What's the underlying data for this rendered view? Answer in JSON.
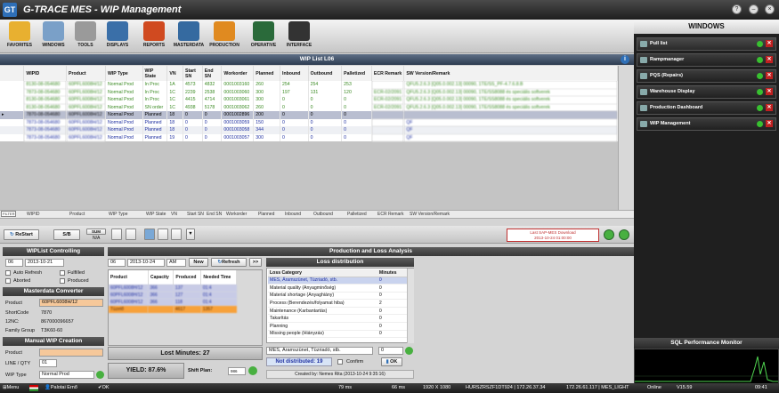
{
  "app": {
    "title": "G-TRACE MES  -  WIP Management",
    "logo": "GT"
  },
  "toolbar": [
    {
      "label": "FAVORITES",
      "icon": "star-folder-icon",
      "color": "#e8b030"
    },
    {
      "label": "WINDOWS",
      "icon": "windows-icon",
      "color": "#7aa0c8"
    },
    {
      "label": "TOOLS",
      "icon": "tools-icon",
      "color": "#9a9a9a"
    },
    {
      "label": "DISPLAYS",
      "icon": "display-icon",
      "color": "#3a6fa8"
    },
    {
      "label": "REPORTS",
      "icon": "bar-chart-icon",
      "color": "#d04a20"
    },
    {
      "label": "MASTERDATA",
      "icon": "database-icon",
      "color": "#356aa0"
    },
    {
      "label": "PRODUCTION",
      "icon": "factory-icon",
      "color": "#e08a20"
    },
    {
      "label": "OPERATIVE",
      "icon": "monitor-chart-icon",
      "color": "#2a6a3a"
    },
    {
      "label": "INTERFACE",
      "icon": "interface-icon",
      "color": "#333333"
    }
  ],
  "windows": {
    "header": "WINDOWS",
    "items": [
      "Pull list",
      "Rampmanager",
      "PQS (Repairs)",
      "Warehouse Display",
      "Production Dashboard",
      "WIP Management"
    ],
    "sql_title": "SQL Performance Monitor"
  },
  "wip": {
    "title": "WIP List L06",
    "columns": [
      "WIPID",
      "Product",
      "WIP Type",
      "WIP State",
      "VN",
      "Start SN",
      "End SN",
      "Workorder",
      "Planned",
      "Inbound",
      "Outbound",
      "Palletized",
      "ECR Remark",
      "SW Version/Remark"
    ],
    "rows": [
      {
        "cls": "g",
        "cells": [
          "8130-08-054680",
          "60PFL6008H/12",
          "Normal Prod",
          "In Proc",
          "1A",
          "4573",
          "4832",
          "0001003160",
          "260",
          "254",
          "254",
          "253",
          "",
          "QFU5.2.6.3 [Q05.0.002.13] 00090, 1TE/SS_PF-4.7.6.8.B"
        ]
      },
      {
        "cls": "g",
        "cells": [
          "7873-08-054680",
          "60PFL6008H/12",
          "Normal Prod",
          "In Proc",
          "1C",
          "2239",
          "2538",
          "0001003060",
          "300",
          "197",
          "131",
          "120",
          "ECR-02/2091",
          "QFU5.2.6.3 [Q05.0.002.13] 00090, 1TE/SS8088 és speciális softverek"
        ]
      },
      {
        "cls": "g",
        "cells": [
          "8130-08-054680",
          "60PFL6008H/12",
          "Normal Prod",
          "In Proc",
          "1C",
          "4415",
          "4714",
          "0001003061",
          "300",
          "0",
          "0",
          "0",
          "ECR-02/2091",
          "QFU5.2.6.3 [Q05.0.002.13] 00090, 1TE/SS8088 és speciális softverek"
        ]
      },
      {
        "cls": "g",
        "cells": [
          "8130-08-054680",
          "60PFL6008H/12",
          "Normal Prod",
          "SN order",
          "1C",
          "4938",
          "5178",
          "0001003062",
          "260",
          "0",
          "0",
          "0",
          "ECR-02/2091",
          "QFU5.2.6.3 [Q05.0.002.13] 00090, 1TE/SS8088 és speciális softverek"
        ]
      },
      {
        "cls": "b sel",
        "cells": [
          "7870-08-054680",
          "60PFL6008H/12",
          "Normal Prod",
          "Planned",
          "18",
          "0",
          "0",
          "0001002896",
          "200",
          "0",
          "0",
          "0",
          "",
          ""
        ]
      },
      {
        "cls": "b",
        "cells": [
          "7873-08-054680",
          "60PFL6008H/12",
          "Normal Prod",
          "Planned",
          "18",
          "0",
          "0",
          "0001003059",
          "150",
          "0",
          "0",
          "0",
          "",
          "QF"
        ]
      },
      {
        "cls": "b alt",
        "cells": [
          "7873-08-054680",
          "60PFL6008H/12",
          "Normal Prod",
          "Planned",
          "18",
          "0",
          "0",
          "0001003058",
          "344",
          "0",
          "0",
          "0",
          "",
          "QF"
        ]
      },
      {
        "cls": "b",
        "cells": [
          "7873-08-054680",
          "60PFL6008H/12",
          "Normal Prod",
          "Planned",
          "19",
          "0",
          "0",
          "0001003057",
          "300",
          "0",
          "0",
          "0",
          "",
          "QF"
        ]
      }
    ],
    "filter_tag": "FILTER"
  },
  "lowerbar": {
    "restart": "ReStart",
    "sb": "S/B",
    "sum_label": "SUM",
    "sum_value": "N/A",
    "sap_line1": "Last SAP-MES Download",
    "sap_line2": "2013-10-24 01:00:00"
  },
  "wiplist": {
    "header": "WIPList Controlling",
    "day": "06",
    "date": "2013-10-21",
    "auto_refresh": "Auto Refresh",
    "fulfilled": "Fulfilled",
    "aborted": "Aborted",
    "produced": "Produced",
    "mdc_header": "Masterdata Converter",
    "product_label": "Product",
    "product_value": "60PFL6008H/12",
    "shortcode_label": "ShortCode",
    "shortcode_value": "7870",
    "nc_label": "12NC:",
    "nc_value": "867000096657",
    "family_label": "Family Group",
    "family_value": "T3K60-60",
    "manual_header": "Manual WIP Creation",
    "m_product": "Product",
    "m_line": "LINE / QTY",
    "m_line_value": "01",
    "m_type": "WIP Type",
    "m_type_value": "Normal Prod"
  },
  "pla": {
    "header": "Production and Loss Analysis",
    "day": "06",
    "date": "2013-10-24",
    "ampm": "AM",
    "new": "New",
    "refresh": "Refresh",
    "more": ">>",
    "table_headers": [
      "Product",
      "Capacity",
      "Produced",
      "Needed Time"
    ],
    "rows": [
      {
        "cls": "blue",
        "cells": [
          "60PFL6008H/12",
          "366",
          "137",
          "01:4"
        ]
      },
      {
        "cls": "blue",
        "cells": [
          "60PFL6008H/12",
          "366",
          "127",
          "01:4"
        ]
      },
      {
        "cls": "blue",
        "cells": [
          "60PFL6008H/12",
          "366",
          "118",
          "01:4"
        ]
      },
      {
        "cls": "orange",
        "cells": [
          "Tüzelő",
          "",
          "4617",
          "1357"
        ]
      }
    ],
    "lost_minutes": "Lost Minutes: 27",
    "yield": "YIELD: 87.6%",
    "shift_plan_label": "Shift Plan:",
    "shift_plan_value": "986",
    "loss_header": "Loss distribution",
    "loss_cols": [
      "Loss Category",
      "Minutes"
    ],
    "loss_rows": [
      [
        "MES, Áramszünet, Tüzriadó, stb.",
        "0"
      ],
      [
        "Material quality (Anyagminőség)",
        "0"
      ],
      [
        "Material shortage (Anyaghiány)",
        "0"
      ],
      [
        "Process (Berendezés/folyamat hiba)",
        "2"
      ],
      [
        "Maintenance (Karbantartás)",
        "0"
      ],
      [
        "Takarítás",
        "0"
      ],
      [
        "Planning",
        "0"
      ],
      [
        "Missing people (Hiányzás)",
        "0"
      ]
    ],
    "loss_select": "MES, Áramszünet, Tüzriadó, stb.",
    "loss_input": "0",
    "not_distributed": "Not distributed: 19",
    "confirm": "Confirm",
    "ok": "OK",
    "created_by": "Created by: Nemes Rita (2013-10-24 9:35:16)"
  },
  "status": {
    "menu": "Menu",
    "user": "Palotai Ernő",
    "ok": "OK",
    "ms1": "79 ms",
    "ms2": "66 ms",
    "res": "1920 X 1080",
    "host1": "HURSZRSZF1DT924 | 172.26.37.34",
    "host2": "172.26.61.117 | MES_LIGHT",
    "online": "Online",
    "ver": "V15.59",
    "time": "09:41"
  }
}
